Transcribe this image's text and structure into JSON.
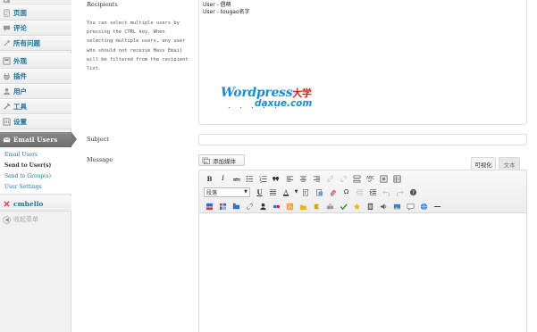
{
  "sidebar": {
    "items": [
      {
        "label": "",
        "icon": "media-icon"
      },
      {
        "label": "页面",
        "icon": "page-icon"
      },
      {
        "label": "评论",
        "icon": "comment-icon"
      },
      {
        "label": "所有问题",
        "icon": "question-icon"
      },
      {
        "label": "外观",
        "icon": "appearance-icon"
      },
      {
        "label": "插件",
        "icon": "plugin-icon"
      },
      {
        "label": "用户",
        "icon": "users-icon"
      },
      {
        "label": "工具",
        "icon": "tools-icon"
      },
      {
        "label": "设置",
        "icon": "settings-icon"
      }
    ],
    "active": {
      "label": "Email Users",
      "icon": "email-icon"
    },
    "submenu": [
      "Email Users",
      "Send to User(s)",
      "Send to Group(s)",
      "User Settings"
    ],
    "submenu_current": "Send to User(s)",
    "extra": {
      "label": "cmhello",
      "icon": "cmhello-icon"
    },
    "collapse": "收起菜单"
  },
  "form": {
    "recipients_label": "Recipients",
    "help": "You can select multiple users by pressing the CTRL key. When selecting multiple users, any user who should not receive Mass Email will be filtered from the recipient list.",
    "recipients": [
      "User - 倡萌",
      "User - tougao名字"
    ],
    "subject_label": "Subject",
    "subject_value": "",
    "message_label": "Message",
    "add_media": "添加媒体",
    "tab_visual": "可视化",
    "tab_text": "文本",
    "format_select": "段落"
  },
  "watermark": {
    "line1": "Wordpress",
    "line1_cn": "大学",
    "line2": "daxue.com",
    "dots": ". . . . ."
  },
  "colors": {
    "link": "#21759b",
    "active_menu": "#777777",
    "watermark_blue": "#1a8bd0",
    "watermark_red": "#d81e1e"
  }
}
